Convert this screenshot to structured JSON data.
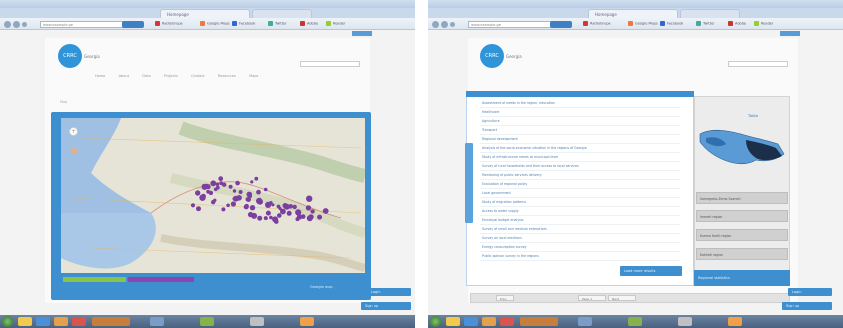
{
  "left": {
    "browser": {
      "tabs": [
        {
          "label": "Homepage"
        },
        {
          "label": ""
        }
      ],
      "url": "www.example.ge",
      "bookmarks": [
        "RadioGrupa",
        "Google Maps",
        "Facebook",
        "Twitter",
        "Adobe",
        "Reader"
      ]
    },
    "site": {
      "logo": "CRRC",
      "logo_text": "Georgia",
      "menu": [
        "Home",
        "About",
        "Data",
        "Projects",
        "Contact",
        "Resources",
        "Maps"
      ],
      "crumb": "Map",
      "legend": [
        "",
        ""
      ],
      "map_footer": "Georgia map"
    },
    "side_buttons": [
      "Login",
      "Sign up"
    ]
  },
  "right": {
    "browser": {
      "tabs": [
        {
          "label": "Homepage"
        },
        {
          "label": ""
        }
      ],
      "url": "www.example.ge",
      "bookmarks": [
        "RadioGrupa",
        "Google Maps",
        "Facebook",
        "Twitter",
        "Adobe",
        "Reader"
      ]
    },
    "site": {
      "logo": "CRRC",
      "logo_text": "Georgia"
    },
    "list": {
      "rows": [
        "Assessment of needs in the region, education",
        "Healthcare",
        "Agriculture",
        "Transport",
        "Regional development",
        "Analysis of the socio-economic situation in the regions of Georgia",
        "Study of infrastructure needs at municipal level",
        "Survey of rural households and their access to local services",
        "Monitoring of public services delivery",
        "Evaluation of regional policy",
        "Local government",
        "Study of migration patterns",
        "Access to water supply",
        "Municipal budget analysis",
        "Survey of small and medium enterprises",
        "Survey on local elections",
        "Energy consumption survey",
        "Public opinion survey in the regions"
      ],
      "action": "Load more results"
    },
    "region": {
      "title": "Tbilisi",
      "buttons": [
        "Samegrelo-Zemo Svaneti",
        "Imereti region",
        "Kvemo Kartli region",
        "Kakheti region"
      ],
      "footer": "Regional statistics"
    },
    "bottom": [
      "Prev",
      "Page 1",
      "Next"
    ],
    "side_buttons": [
      "Login",
      "Sign up"
    ]
  },
  "colors": {
    "accent": "#3d8fcf",
    "marker": "#7b3fa0",
    "legend_green": "#8bc34a",
    "legend_purple": "#8e44ad"
  },
  "icons": [
    "windows-start-icon",
    "zoom-in-icon",
    "pan-icon"
  ]
}
